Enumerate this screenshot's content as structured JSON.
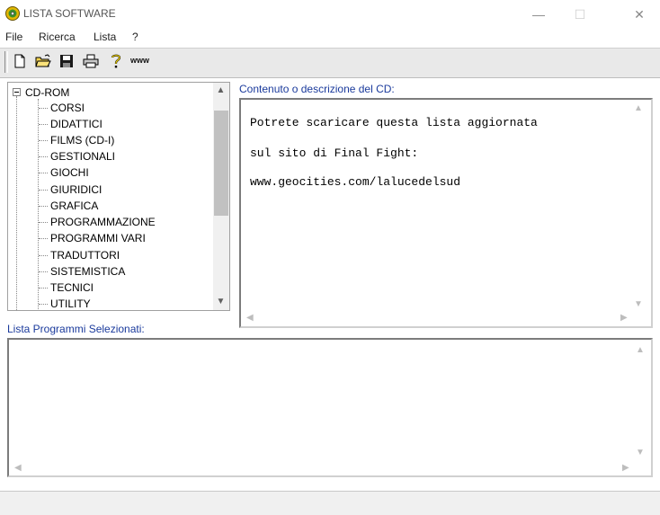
{
  "window": {
    "title": "LISTA SOFTWARE",
    "min_glyph": "—",
    "max_glyph": "☐",
    "close_glyph": "✕"
  },
  "menu": [
    "File",
    "Ricerca",
    "Lista",
    "?"
  ],
  "toolbar": {
    "www_label": "www"
  },
  "tree": {
    "root": "CD-ROM",
    "items": [
      "CORSI",
      "DIDATTICI",
      "FILMS (CD-I)",
      "GESTIONALI",
      "GIOCHI",
      "GIURIDICI",
      "GRAFICA",
      "PROGRAMMAZIONE",
      "PROGRAMMI VARI",
      "TRADUTTORI",
      "SISTEMISTICA",
      "TECNICI",
      "UTILITY"
    ]
  },
  "description": {
    "label": "Contenuto o descrizione del CD:",
    "lines": [
      "Potrete scaricare questa lista aggiornata",
      "sul sito di Final Fight:",
      "www.geocities.com/lalucedelsud"
    ]
  },
  "selected": {
    "label": "Lista Programmi Selezionati:"
  }
}
